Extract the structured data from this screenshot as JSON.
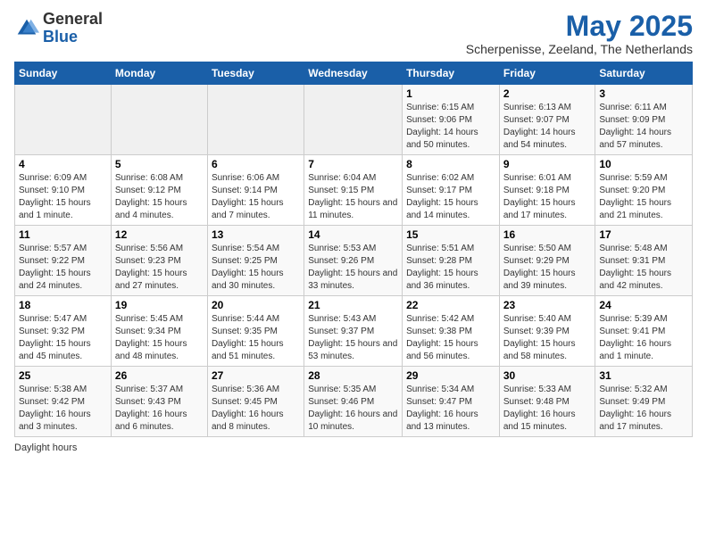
{
  "logo": {
    "general": "General",
    "blue": "Blue"
  },
  "header": {
    "month": "May 2025",
    "location": "Scherpenisse, Zeeland, The Netherlands"
  },
  "days_of_week": [
    "Sunday",
    "Monday",
    "Tuesday",
    "Wednesday",
    "Thursday",
    "Friday",
    "Saturday"
  ],
  "footer": {
    "daylight_label": "Daylight hours"
  },
  "weeks": [
    [
      {
        "num": "",
        "empty": true
      },
      {
        "num": "",
        "empty": true
      },
      {
        "num": "",
        "empty": true
      },
      {
        "num": "",
        "empty": true
      },
      {
        "num": "1",
        "sunrise": "6:15 AM",
        "sunset": "9:06 PM",
        "daylight": "14 hours and 50 minutes."
      },
      {
        "num": "2",
        "sunrise": "6:13 AM",
        "sunset": "9:07 PM",
        "daylight": "14 hours and 54 minutes."
      },
      {
        "num": "3",
        "sunrise": "6:11 AM",
        "sunset": "9:09 PM",
        "daylight": "14 hours and 57 minutes."
      }
    ],
    [
      {
        "num": "4",
        "sunrise": "6:09 AM",
        "sunset": "9:10 PM",
        "daylight": "15 hours and 1 minute."
      },
      {
        "num": "5",
        "sunrise": "6:08 AM",
        "sunset": "9:12 PM",
        "daylight": "15 hours and 4 minutes."
      },
      {
        "num": "6",
        "sunrise": "6:06 AM",
        "sunset": "9:14 PM",
        "daylight": "15 hours and 7 minutes."
      },
      {
        "num": "7",
        "sunrise": "6:04 AM",
        "sunset": "9:15 PM",
        "daylight": "15 hours and 11 minutes."
      },
      {
        "num": "8",
        "sunrise": "6:02 AM",
        "sunset": "9:17 PM",
        "daylight": "15 hours and 14 minutes."
      },
      {
        "num": "9",
        "sunrise": "6:01 AM",
        "sunset": "9:18 PM",
        "daylight": "15 hours and 17 minutes."
      },
      {
        "num": "10",
        "sunrise": "5:59 AM",
        "sunset": "9:20 PM",
        "daylight": "15 hours and 21 minutes."
      }
    ],
    [
      {
        "num": "11",
        "sunrise": "5:57 AM",
        "sunset": "9:22 PM",
        "daylight": "15 hours and 24 minutes."
      },
      {
        "num": "12",
        "sunrise": "5:56 AM",
        "sunset": "9:23 PM",
        "daylight": "15 hours and 27 minutes."
      },
      {
        "num": "13",
        "sunrise": "5:54 AM",
        "sunset": "9:25 PM",
        "daylight": "15 hours and 30 minutes."
      },
      {
        "num": "14",
        "sunrise": "5:53 AM",
        "sunset": "9:26 PM",
        "daylight": "15 hours and 33 minutes."
      },
      {
        "num": "15",
        "sunrise": "5:51 AM",
        "sunset": "9:28 PM",
        "daylight": "15 hours and 36 minutes."
      },
      {
        "num": "16",
        "sunrise": "5:50 AM",
        "sunset": "9:29 PM",
        "daylight": "15 hours and 39 minutes."
      },
      {
        "num": "17",
        "sunrise": "5:48 AM",
        "sunset": "9:31 PM",
        "daylight": "15 hours and 42 minutes."
      }
    ],
    [
      {
        "num": "18",
        "sunrise": "5:47 AM",
        "sunset": "9:32 PM",
        "daylight": "15 hours and 45 minutes."
      },
      {
        "num": "19",
        "sunrise": "5:45 AM",
        "sunset": "9:34 PM",
        "daylight": "15 hours and 48 minutes."
      },
      {
        "num": "20",
        "sunrise": "5:44 AM",
        "sunset": "9:35 PM",
        "daylight": "15 hours and 51 minutes."
      },
      {
        "num": "21",
        "sunrise": "5:43 AM",
        "sunset": "9:37 PM",
        "daylight": "15 hours and 53 minutes."
      },
      {
        "num": "22",
        "sunrise": "5:42 AM",
        "sunset": "9:38 PM",
        "daylight": "15 hours and 56 minutes."
      },
      {
        "num": "23",
        "sunrise": "5:40 AM",
        "sunset": "9:39 PM",
        "daylight": "15 hours and 58 minutes."
      },
      {
        "num": "24",
        "sunrise": "5:39 AM",
        "sunset": "9:41 PM",
        "daylight": "16 hours and 1 minute."
      }
    ],
    [
      {
        "num": "25",
        "sunrise": "5:38 AM",
        "sunset": "9:42 PM",
        "daylight": "16 hours and 3 minutes."
      },
      {
        "num": "26",
        "sunrise": "5:37 AM",
        "sunset": "9:43 PM",
        "daylight": "16 hours and 6 minutes."
      },
      {
        "num": "27",
        "sunrise": "5:36 AM",
        "sunset": "9:45 PM",
        "daylight": "16 hours and 8 minutes."
      },
      {
        "num": "28",
        "sunrise": "5:35 AM",
        "sunset": "9:46 PM",
        "daylight": "16 hours and 10 minutes."
      },
      {
        "num": "29",
        "sunrise": "5:34 AM",
        "sunset": "9:47 PM",
        "daylight": "16 hours and 13 minutes."
      },
      {
        "num": "30",
        "sunrise": "5:33 AM",
        "sunset": "9:48 PM",
        "daylight": "16 hours and 15 minutes."
      },
      {
        "num": "31",
        "sunrise": "5:32 AM",
        "sunset": "9:49 PM",
        "daylight": "16 hours and 17 minutes."
      }
    ]
  ]
}
